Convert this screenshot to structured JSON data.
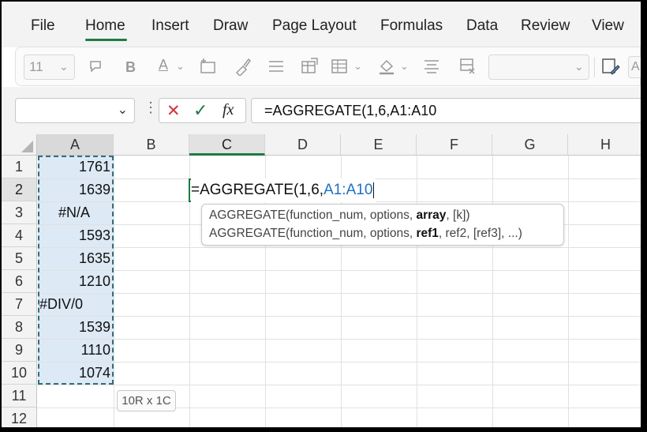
{
  "menu": {
    "items": [
      "File",
      "Home",
      "Insert",
      "Draw",
      "Page Layout",
      "Formulas",
      "Data",
      "Review",
      "View"
    ],
    "active": "Home"
  },
  "ribbon": {
    "font_size_value": "11",
    "icons": [
      "wrap-text-icon",
      "bold-icon",
      "font-color-icon",
      "insert-cells-icon",
      "format-painter-icon",
      "align-icon",
      "format-cells-icon",
      "conditional-format-icon",
      "fill-color-icon",
      "justify-icon",
      "delete-cells-icon",
      "number-format-dropdown",
      "paste-format-icon"
    ],
    "bold_label": "B",
    "font_color_label": "A",
    "trailing_label": "A"
  },
  "formula_bar": {
    "name_box_value": "",
    "cancel_glyph": "✕",
    "enter_glyph": "✓",
    "fx_label": "fx",
    "formula_text": "=AGGREGATE(1,6,A1:A10"
  },
  "grid": {
    "columns": [
      "A",
      "B",
      "C",
      "D",
      "E",
      "F",
      "G",
      "H"
    ],
    "rows": [
      "1",
      "2",
      "3",
      "4",
      "5",
      "6",
      "7",
      "8",
      "9",
      "10",
      "11",
      "12"
    ],
    "column_a_values": [
      "1761",
      "1639",
      "#N/A",
      "1593",
      "1635",
      "1210",
      "#DIV/0",
      "1539",
      "1110",
      "1074"
    ],
    "active_cell": {
      "prefix": "=AGGREGATE(1,6,",
      "reference": "A1:A10"
    }
  },
  "tooltip": {
    "line1": {
      "pre": "AGGREGATE(function_num, options, ",
      "bold": "array",
      "post": ", [k])"
    },
    "line2": {
      "pre": "AGGREGATE(function_num, options, ",
      "bold": "ref1",
      "post": ", ref2, [ref3], ...)"
    }
  },
  "size_indicator": "10R x 1C",
  "colors": {
    "accent_green": "#1f7a46",
    "reference_blue": "#1e6fc4",
    "selection_fill": "#dde9f5",
    "marching_ants": "#2f6f7a"
  }
}
